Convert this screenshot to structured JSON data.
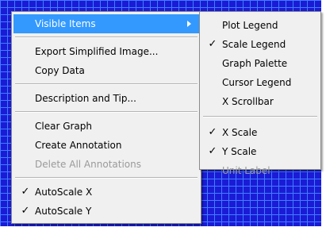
{
  "main_menu": {
    "visible_items": "Visible Items",
    "export_simplified_image": "Export Simplified Image...",
    "copy_data": "Copy Data",
    "description_and_tip": "Description and Tip...",
    "clear_graph": "Clear Graph",
    "create_annotation": "Create Annotation",
    "delete_all_annotations": "Delete All Annotations",
    "autoscale_x": "AutoScale X",
    "autoscale_y": "AutoScale Y"
  },
  "submenu": {
    "plot_legend": "Plot Legend",
    "scale_legend": "Scale Legend",
    "graph_palette": "Graph Palette",
    "cursor_legend": "Cursor Legend",
    "x_scrollbar": "X Scrollbar",
    "x_scale": "X Scale",
    "y_scale": "Y Scale",
    "unit_label": "Unit Label"
  },
  "check_mark": "✓",
  "colors": {
    "highlight": "#3399ff",
    "graph_background": "#1b1bd6",
    "grid_lines": "#3f7dff",
    "disabled_text": "#9a9a9a"
  },
  "icons": {
    "submenu_arrow": "triangle-right",
    "check": "check-mark"
  }
}
